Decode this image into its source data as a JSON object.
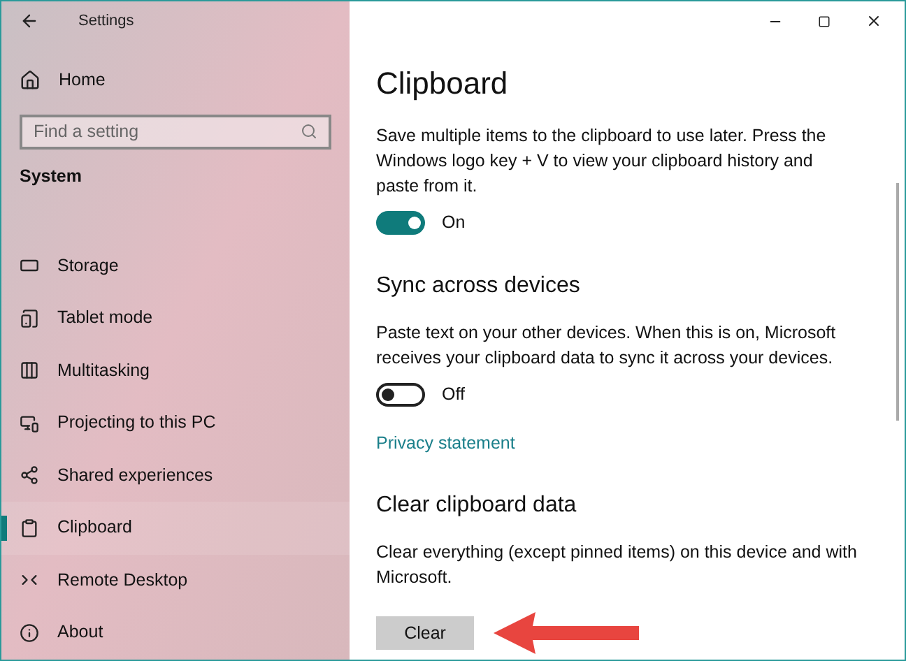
{
  "window": {
    "title": "Settings"
  },
  "sidebar": {
    "home": "Home",
    "search": {
      "placeholder": "Find a setting"
    },
    "section": "System",
    "items": [
      {
        "label": "Storage",
        "selected": false
      },
      {
        "label": "Tablet mode",
        "selected": false
      },
      {
        "label": "Multitasking",
        "selected": false
      },
      {
        "label": "Projecting to this PC",
        "selected": false
      },
      {
        "label": "Shared experiences",
        "selected": false
      },
      {
        "label": "Clipboard",
        "selected": true
      },
      {
        "label": "Remote Desktop",
        "selected": false
      },
      {
        "label": "About",
        "selected": false
      }
    ]
  },
  "page": {
    "title": "Clipboard",
    "blocks": [
      {
        "kind": "paragraph",
        "text": "Save multiple items to the clipboard to use later. Press the Windows logo key + V to view your clipboard history and paste from it."
      },
      {
        "kind": "toggle",
        "on": true,
        "label": "On"
      },
      {
        "kind": "heading",
        "text": "Sync across devices"
      },
      {
        "kind": "paragraph",
        "text": "Paste text on your other devices. When this is on, Microsoft receives your clipboard data to sync it across your devices."
      },
      {
        "kind": "toggle",
        "on": false,
        "label": "Off"
      },
      {
        "kind": "link",
        "text": "Privacy statement"
      },
      {
        "kind": "heading",
        "text": "Clear clipboard data"
      },
      {
        "kind": "paragraph",
        "text": "Clear everything (except pinned items) on this device and with Microsoft."
      },
      {
        "kind": "button",
        "text": "Clear"
      }
    ]
  }
}
